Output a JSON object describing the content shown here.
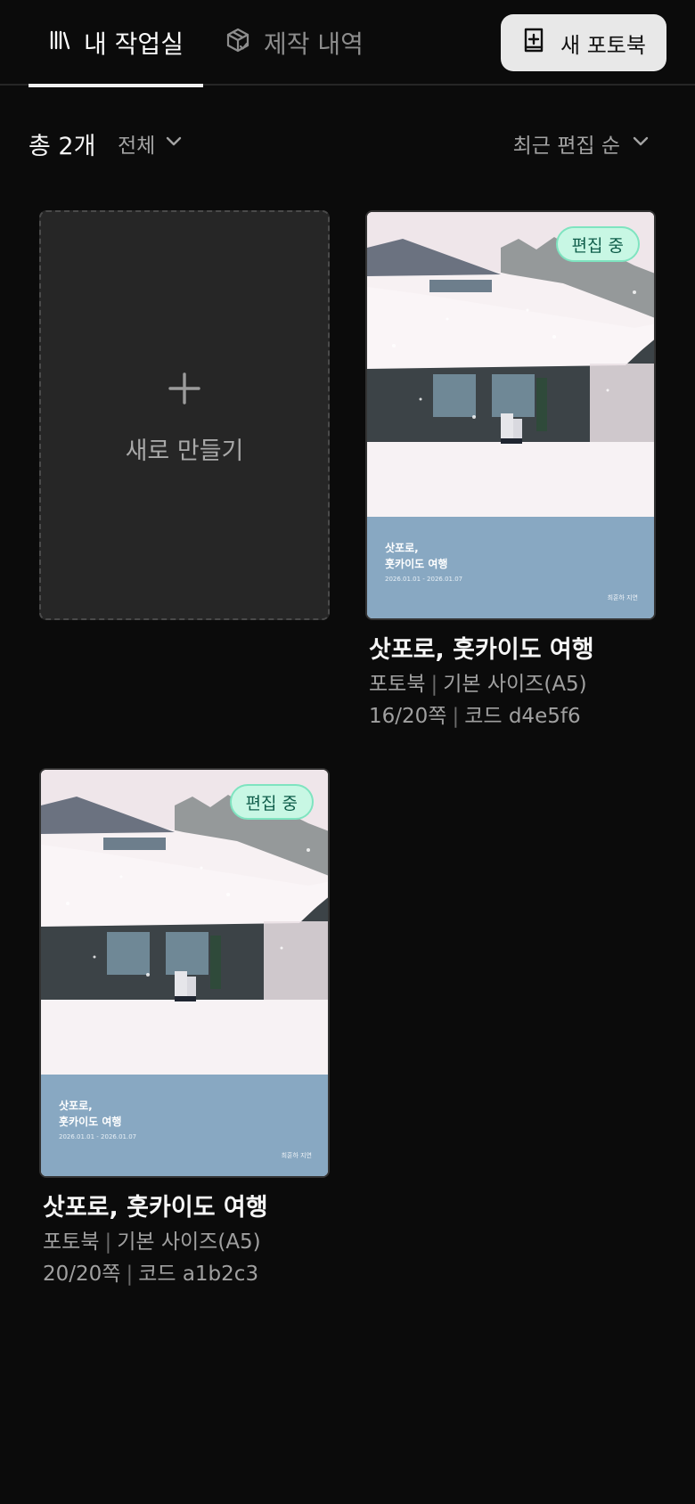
{
  "header": {
    "tabs": [
      {
        "label": "내 작업실",
        "active": true,
        "icon": "library-icon"
      },
      {
        "label": "제작 내역",
        "active": false,
        "icon": "package-check-icon"
      }
    ],
    "new_button_label": "새 포토북",
    "new_button_icon": "book-plus-icon"
  },
  "toolbar": {
    "count_label": "총 2개",
    "filter_label": "전체",
    "sort_label": "최근 편집 순"
  },
  "create_card": {
    "label": "새로 만들기"
  },
  "books": [
    {
      "badge": "편집 중",
      "cover_title_line1": "삿포로,",
      "cover_title_line2": "훗카이도 여행",
      "cover_date": "2026.01.01 - 2026.01.07",
      "cover_author": "최훈하 지연",
      "title": "삿포로, 훗카이도 여행",
      "type": "포토북",
      "size": "기본 사이즈(A5)",
      "pages": "16/20쪽",
      "code": "코드 d4e5f6"
    },
    {
      "badge": "편집 중",
      "cover_title_line1": "삿포로,",
      "cover_title_line2": "훗카이도 여행",
      "cover_date": "2026.01.01 - 2026.01.07",
      "cover_author": "최훈하 지연",
      "title": "삿포로, 훗카이도 여행",
      "type": "포토북",
      "size": "기본 사이즈(A5)",
      "pages": "20/20쪽",
      "code": "코드 a1b2c3"
    }
  ],
  "colors": {
    "background": "#0b0b0b",
    "badge_bg": "#c8f7e4",
    "cover_band": "#88a8c2",
    "new_button_bg": "#e8e8e8"
  }
}
